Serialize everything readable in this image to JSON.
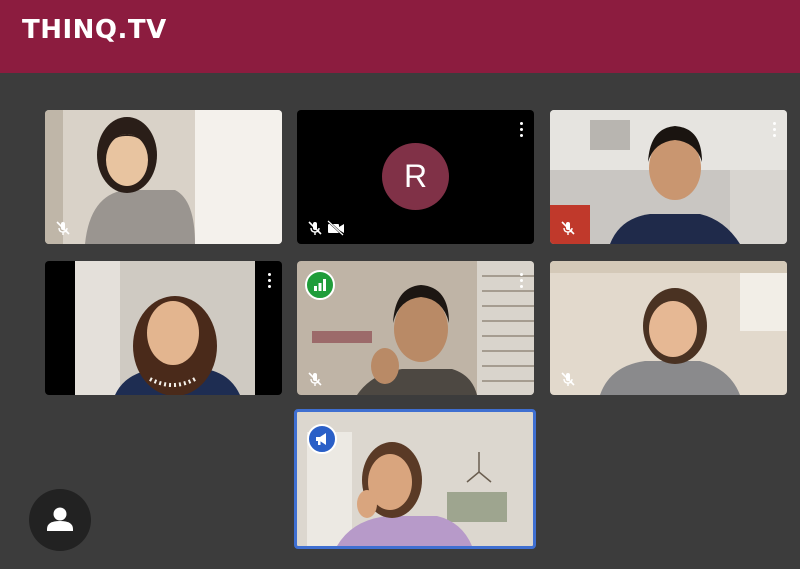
{
  "app": {
    "brand": "THINQ.TV",
    "brand_color": "#8c1c3f"
  },
  "participants": [
    {
      "id": "p1",
      "mic": "muted",
      "camera": "on"
    },
    {
      "id": "p2",
      "initial": "R",
      "mic": "muted",
      "camera": "off",
      "avatar_color": "#803147"
    },
    {
      "id": "p3",
      "mic": "muted",
      "camera": "on"
    },
    {
      "id": "p4",
      "mic": "on",
      "camera": "on"
    },
    {
      "id": "p5",
      "mic": "muted",
      "camera": "on",
      "badge": "signal-icon",
      "badge_color": "#1f9d3a"
    },
    {
      "id": "p6",
      "mic": "muted",
      "camera": "on"
    },
    {
      "id": "p7",
      "mic": "on",
      "camera": "on",
      "badge": "megaphone-icon",
      "badge_color": "#2a5fc7",
      "highlight_color": "#3f6fd1"
    }
  ],
  "controls": {
    "profile_icon": "person-icon"
  }
}
